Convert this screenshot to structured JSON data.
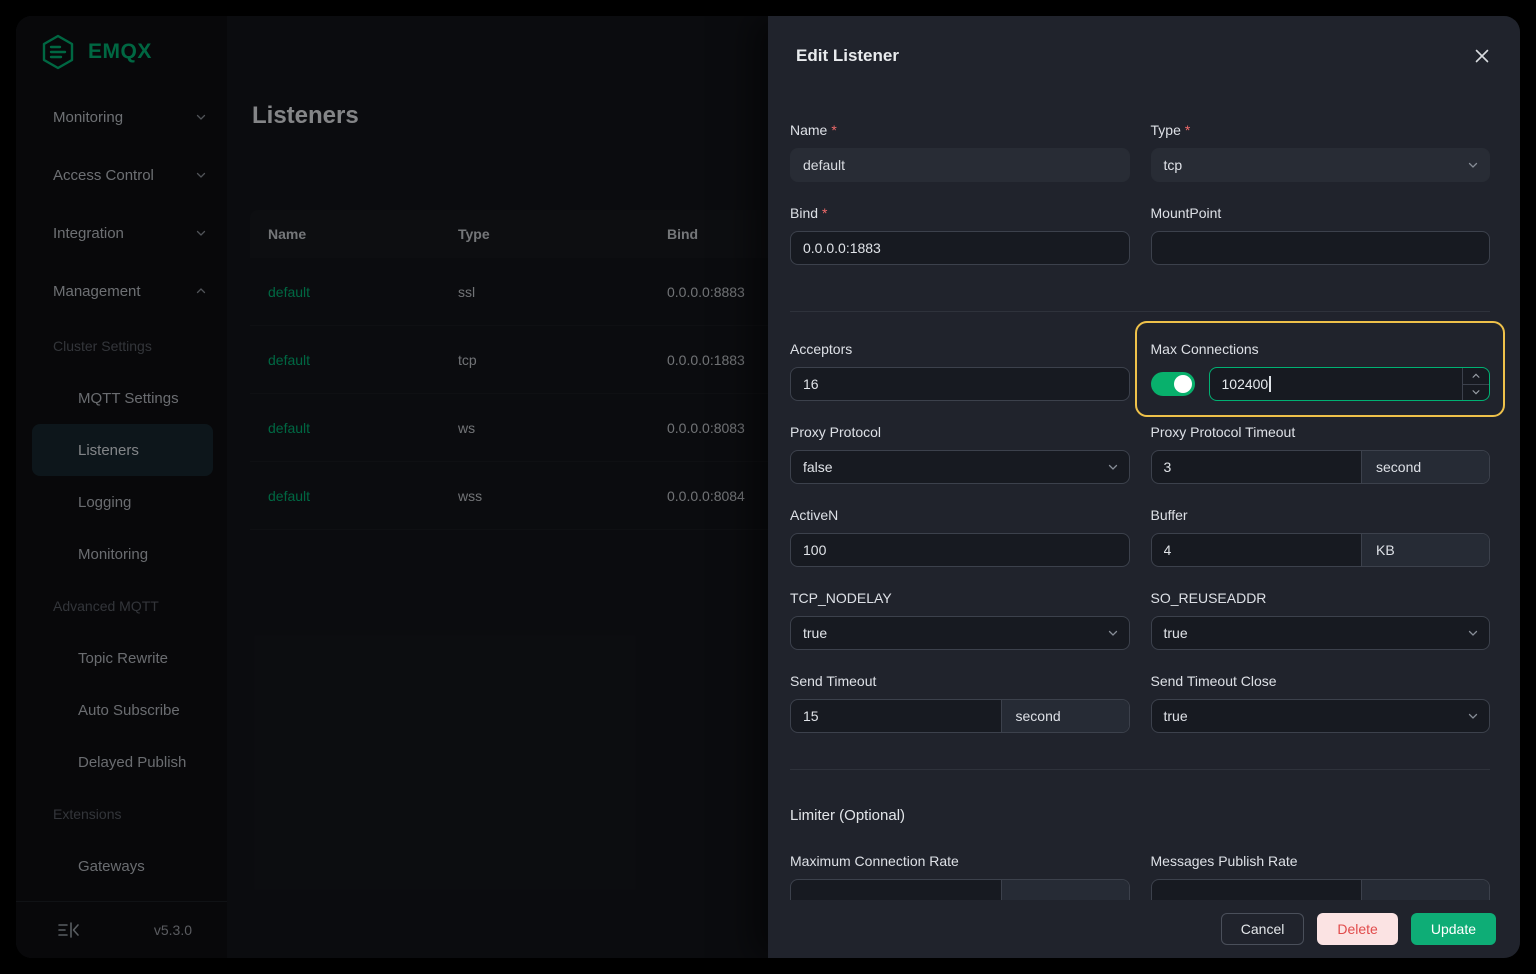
{
  "brand": {
    "name": "EMQX"
  },
  "sidebar": {
    "items": [
      {
        "label": "Monitoring"
      },
      {
        "label": "Access Control"
      },
      {
        "label": "Integration"
      },
      {
        "label": "Management"
      }
    ],
    "groups": {
      "cluster_settings": "Cluster Settings",
      "advanced_mqtt": "Advanced MQTT",
      "extensions": "Extensions"
    },
    "sub_items": {
      "mqtt_settings": "MQTT Settings",
      "listeners": "Listeners",
      "logging": "Logging",
      "monitoring": "Monitoring",
      "topic_rewrite": "Topic Rewrite",
      "auto_subscribe": "Auto Subscribe",
      "delayed_publish": "Delayed Publish",
      "gateways": "Gateways"
    },
    "version": "v5.3.0"
  },
  "page": {
    "title": "Listeners",
    "table": {
      "headers": {
        "name": "Name",
        "type": "Type",
        "bind": "Bind"
      },
      "rows": [
        {
          "name": "default",
          "type": "ssl",
          "bind": "0.0.0.0:8883"
        },
        {
          "name": "default",
          "type": "tcp",
          "bind": "0.0.0.0:1883"
        },
        {
          "name": "default",
          "type": "ws",
          "bind": "0.0.0.0:8083"
        },
        {
          "name": "default",
          "type": "wss",
          "bind": "0.0.0.0:8084"
        }
      ]
    }
  },
  "drawer": {
    "title": "Edit Listener",
    "required_mark": "*",
    "fields": {
      "name": {
        "label": "Name",
        "value": "default"
      },
      "type": {
        "label": "Type",
        "value": "tcp"
      },
      "bind": {
        "label": "Bind",
        "value": "0.0.0.0:1883"
      },
      "mountpoint": {
        "label": "MountPoint",
        "value": ""
      },
      "acceptors": {
        "label": "Acceptors",
        "value": "16"
      },
      "max_connections": {
        "label": "Max Connections",
        "value": "102400",
        "toggle_state": "on"
      },
      "proxy_protocol": {
        "label": "Proxy Protocol",
        "value": "false"
      },
      "proxy_protocol_timeout": {
        "label": "Proxy Protocol Timeout",
        "value": "3",
        "unit": "second"
      },
      "activen": {
        "label": "ActiveN",
        "value": "100"
      },
      "buffer": {
        "label": "Buffer",
        "value": "4",
        "unit": "KB"
      },
      "tcp_nodelay": {
        "label": "TCP_NODELAY",
        "value": "true"
      },
      "so_reuseaddr": {
        "label": "SO_REUSEADDR",
        "value": "true"
      },
      "send_timeout": {
        "label": "Send Timeout",
        "value": "15",
        "unit": "second"
      },
      "send_timeout_close": {
        "label": "Send Timeout Close",
        "value": "true"
      },
      "limiter_section": {
        "label": "Limiter (Optional)"
      },
      "max_connection_rate": {
        "label": "Maximum Connection Rate"
      },
      "messages_publish_rate": {
        "label": "Messages Publish Rate"
      }
    },
    "buttons": {
      "cancel": "Cancel",
      "delete": "Delete",
      "update": "Update"
    }
  },
  "colors": {
    "accent_green": "#00b173",
    "highlight_gold": "#eec14a",
    "danger_red": "#e14b4b"
  }
}
